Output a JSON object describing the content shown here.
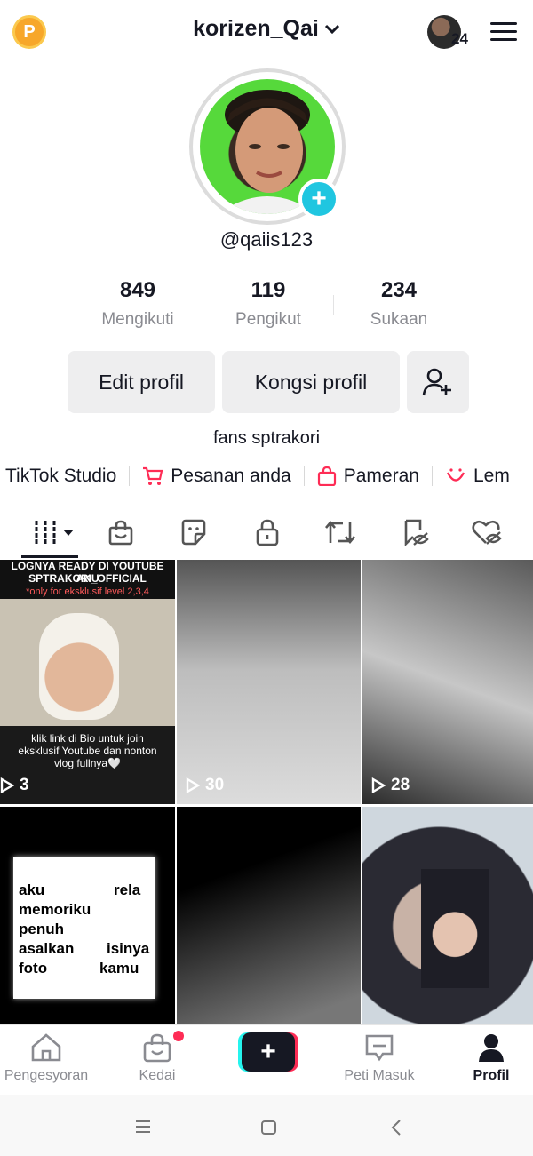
{
  "header": {
    "coin_icon_label": "P",
    "username": "korizen_Qai",
    "notification_count": "24"
  },
  "profile": {
    "handle": "@qaiis123",
    "stats": [
      {
        "value": "849",
        "label": "Mengikuti"
      },
      {
        "value": "119",
        "label": "Pengikut"
      },
      {
        "value": "234",
        "label": "Sukaan"
      }
    ],
    "edit_button": "Edit profil",
    "share_button": "Kongsi profil",
    "bio": "fans sptrakori"
  },
  "shortcuts": [
    {
      "label": "TikTok Studio",
      "icon": "none"
    },
    {
      "label": "Pesanan anda",
      "icon": "cart-icon"
    },
    {
      "label": "Pameran",
      "icon": "shopping-bag-icon"
    },
    {
      "label": "Lem",
      "icon": "smile-icon"
    }
  ],
  "tabs": [
    "videos-grid-icon",
    "shop-icon",
    "sticker-icon",
    "lock-icon",
    "repost-icon",
    "hidden-tag-icon",
    "hidden-heart-icon"
  ],
  "videos": [
    {
      "views": "3",
      "caption_top": "LOGNYA READY DI YOUTUBE AKU",
      "caption_top2": "SPTRAKORI_OFFICIAL",
      "caption_red": "*only for eksklusif level 2,3,4",
      "caption_bottom": "klik link di Bio untuk join eksklusif Youtube dan nonton vlog fullnya🤍"
    },
    {
      "views": "30"
    },
    {
      "views": "28"
    },
    {
      "card_words": [
        "aku",
        "rela",
        "memoriku",
        "penuh",
        "asalkan",
        "isinya",
        "foto",
        "kamu"
      ]
    },
    {},
    {}
  ],
  "nav": [
    {
      "label": "Pengesyoran"
    },
    {
      "label": "Kedai"
    },
    {
      "label": "+"
    },
    {
      "label": "Peti Masuk"
    },
    {
      "label": "Profil"
    }
  ],
  "colors": {
    "accent_red": "#fe2c55",
    "accent_cyan": "#25f4ee",
    "coin": "#f7a72a",
    "plus_badge": "#20c6e0"
  }
}
